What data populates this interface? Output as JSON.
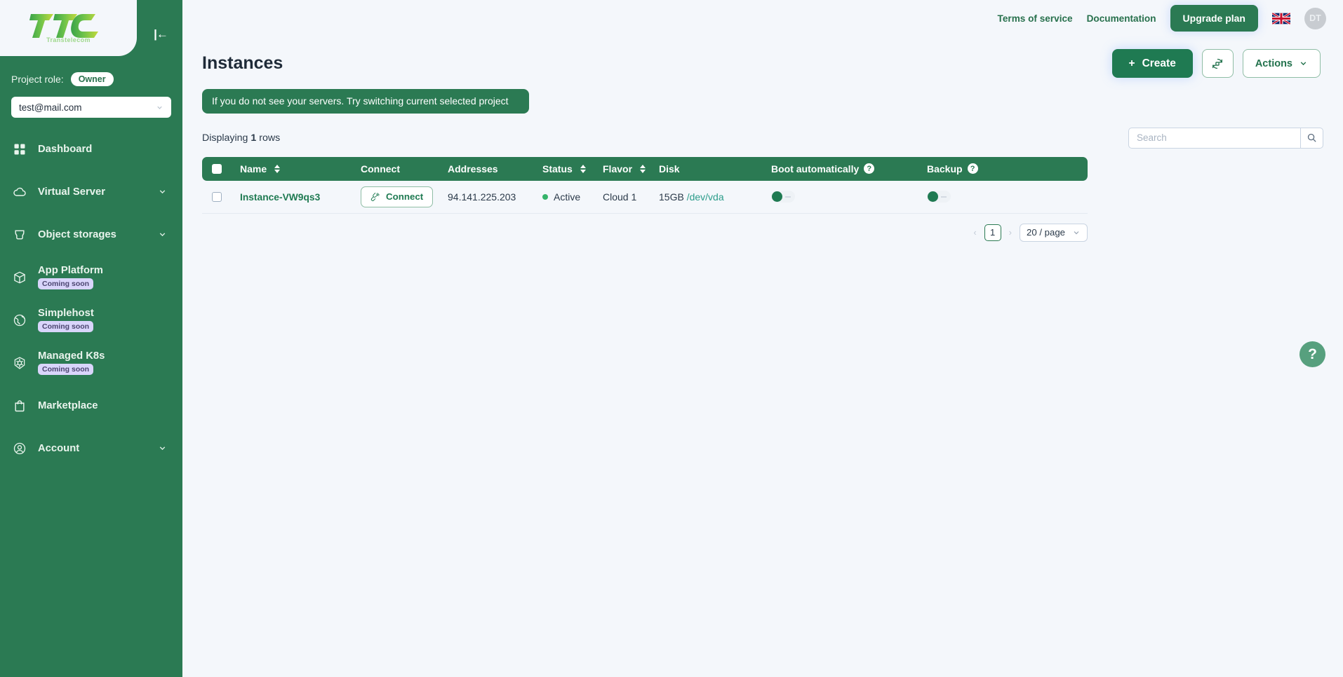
{
  "brand": {
    "logo_text": "TTC",
    "logo_subtitle": "Transtelecom",
    "collapse_icon": "collapse-sidebar-icon",
    "green": "#2b7a53",
    "accent_green": "#1f7a52"
  },
  "sidebar": {
    "project_role_label": "Project role:",
    "project_role_value": "Owner",
    "project_selected": "test@mail.com",
    "items": [
      {
        "label": "Dashboard",
        "icon": "grid-icon",
        "chevron": false,
        "badge": null
      },
      {
        "label": "Virtual Server",
        "icon": "cloud-icon",
        "chevron": true,
        "badge": null
      },
      {
        "label": "Object storages",
        "icon": "bucket-icon",
        "chevron": true,
        "badge": null
      },
      {
        "label": "App Platform",
        "icon": "cube-icon",
        "chevron": false,
        "badge": "Coming soon"
      },
      {
        "label": "Simplehost",
        "icon": "globe-icon",
        "chevron": false,
        "badge": "Coming soon"
      },
      {
        "label": "Managed K8s",
        "icon": "kubernetes-icon",
        "chevron": false,
        "badge": "Coming soon"
      },
      {
        "label": "Marketplace",
        "icon": "shopping-bag-icon",
        "chevron": false,
        "badge": null
      },
      {
        "label": "Account",
        "icon": "user-circle-icon",
        "chevron": true,
        "badge": null
      }
    ]
  },
  "topbar": {
    "terms_link": "Terms of service",
    "documentation_link": "Documentation",
    "upgrade_button": "Upgrade plan",
    "language_flag": "uk-flag-icon",
    "avatar_initials": "DT"
  },
  "page": {
    "title": "Instances",
    "create_button": "Create",
    "create_icon": "plus-icon",
    "refresh_icon": "refresh-instances-icon",
    "actions_button": "Actions",
    "banner": "If you do not see your servers. Try switching current selected project",
    "displaying_prefix": "Displaying",
    "displaying_count": "1",
    "displaying_suffix": "rows"
  },
  "search": {
    "placeholder": "Search",
    "value": "",
    "icon": "search-icon"
  },
  "table": {
    "columns": [
      {
        "label": "Name",
        "sortable": true,
        "help": false
      },
      {
        "label": "Connect",
        "sortable": false,
        "help": false
      },
      {
        "label": "Addresses",
        "sortable": false,
        "help": false
      },
      {
        "label": "Status",
        "sortable": true,
        "help": false
      },
      {
        "label": "Flavor",
        "sortable": true,
        "help": false
      },
      {
        "label": "Disk",
        "sortable": false,
        "help": false
      },
      {
        "label": "Boot automatically",
        "sortable": false,
        "help": true
      },
      {
        "label": "Backup",
        "sortable": false,
        "help": true
      }
    ],
    "rows": [
      {
        "selected": false,
        "name": "Instance-VW9qs3",
        "connect_label": "Connect",
        "connect_icon": "plug-icon",
        "address": "94.141.225.203",
        "status": "Active",
        "status_color": "#35b36a",
        "flavor": "Cloud 1",
        "disk_size": "15GB",
        "disk_device": "/dev/vda",
        "boot_automatically": false,
        "backup": false
      }
    ]
  },
  "pagination": {
    "prev_icon": "chevron-left-icon",
    "next_icon": "chevron-right-icon",
    "current_page": "1",
    "page_size": "20 / page"
  },
  "help_fab": {
    "icon": "question-mark-icon",
    "glyph": "?"
  }
}
